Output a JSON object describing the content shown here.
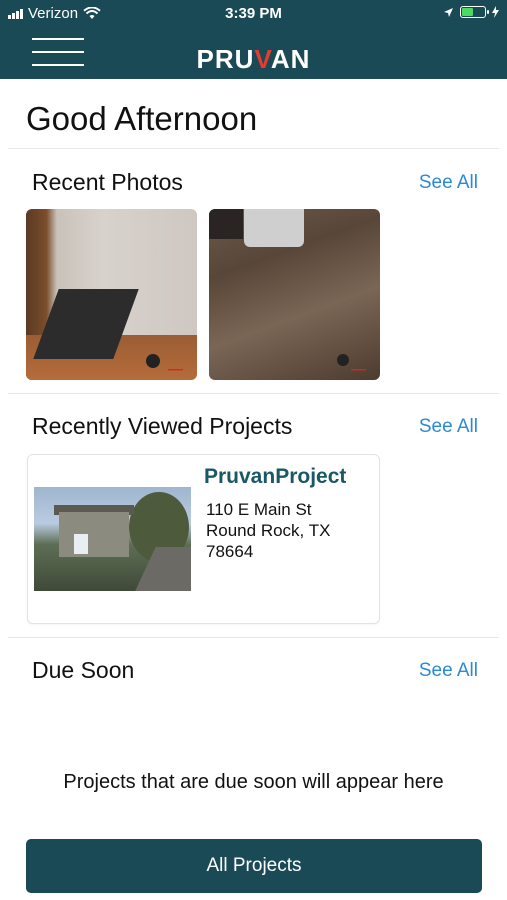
{
  "status_bar": {
    "carrier": "Verizon",
    "time": "3:39 PM",
    "battery_level": 0.5
  },
  "header": {
    "logo_left": "PRU",
    "logo_v": "V",
    "logo_right": "AN"
  },
  "greeting": "Good Afternoon",
  "recent_photos": {
    "title": "Recent Photos",
    "see_all": "See All",
    "photos": [
      {
        "icon": "photo-laptop"
      },
      {
        "icon": "photo-floor"
      }
    ]
  },
  "recent_projects": {
    "title": "Recently Viewed Projects",
    "see_all": "See All",
    "project": {
      "name": "PruvanProject",
      "address_line1": "110 E Main St",
      "address_line2": "Round Rock, TX",
      "address_line3": "78664"
    }
  },
  "due_soon": {
    "title": "Due Soon",
    "see_all": "See All",
    "empty_message": "Projects that are due soon will appear here"
  },
  "all_projects_button": "All Projects",
  "colors": {
    "header_bg": "#1a4a56",
    "link": "#2b8ad6",
    "project_name": "#1b5866",
    "logo_accent": "#e63b2e"
  }
}
